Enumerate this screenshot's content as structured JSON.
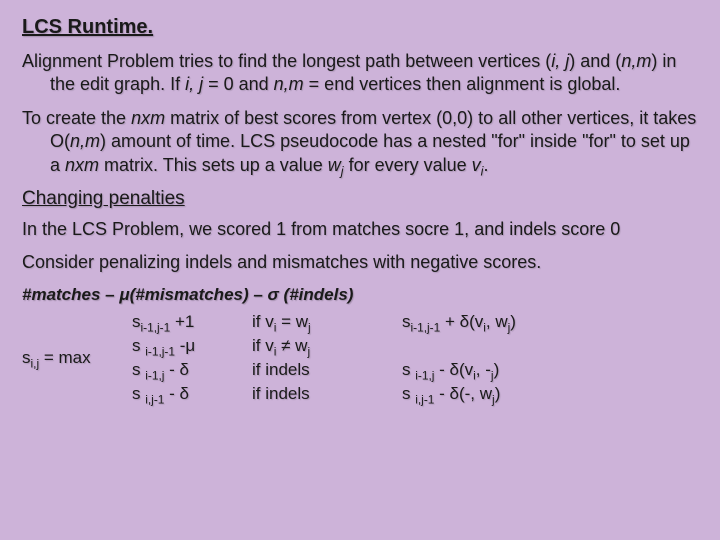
{
  "title": "LCS Runtime.",
  "para1_a": "Alignment Problem tries to find the longest path between vertices (",
  "para1_b": ") and (",
  "para1_c": ") in the edit graph. If ",
  "para1_d": " = 0 and ",
  "para1_e": " = end vertices then alignment is global.",
  "ij": "i, j",
  "nm": "n,m",
  "para2_a": "To create the ",
  "para2_b": " matrix of best scores from vertex (0,0) to all other vertices, it takes O(",
  "para2_c": ") amount of time. LCS pseudocode has a nested \"for\" inside \"for\" to set up a ",
  "para2_d": " matrix. This sets up a value ",
  "para2_e": " for every value ",
  "para2_f": ".",
  "nxm": "nxm",
  "wj": "w",
  "wj_sub": "j",
  "vi": "v",
  "vi_sub": "i",
  "subtitle": "Changing penalties",
  "para3": "In the LCS Problem, we scored 1 from matches socre 1, and indels score 0",
  "para4": "Consider penalizing indels and mismatches with negative scores.",
  "formula_header": "#matches – μ(#mismatches) – σ (#indels)",
  "lhs_a": "s",
  "lhs_sub": "i,j",
  "lhs_b": "  =   max",
  "r1c2_a": "s",
  "r1c2_sub": "i-1,j-1",
  "r1c2_b": " +1",
  "r2c2_a": "s ",
  "r2c2_sub": "i-1,j-1",
  "r2c2_b": " -μ",
  "r3c2_a": "s ",
  "r3c2_sub": "i-1,j",
  "r3c2_b": " - δ",
  "r4c2_a": "s ",
  "r4c2_sub": "i,j-1",
  "r4c2_b": " - δ",
  "r1c3_a": "if v",
  "r1c3_sub1": "i",
  "r1c3_b": " = w",
  "r1c3_sub2": "j",
  "r2c3_a": "if v",
  "r2c3_sub1": "i",
  "r2c3_b": " ≠ w",
  "r2c3_sub2": "j",
  "r3c3": "if indels",
  "r4c3": "if indels",
  "r1c4_a": "s",
  "r1c4_sub": "i-1,j-1",
  "r1c4_b": " + δ(v",
  "r1c4_sub2": "i",
  "r1c4_c": ", w",
  "r1c4_sub3": "j",
  "r1c4_d": ")",
  "r3c4_a": "s ",
  "r3c4_sub": "i-1,j",
  "r3c4_b": " - δ(v",
  "r3c4_sub2": "i",
  "r3c4_c": ", -",
  "r3c4_sub3": "j",
  "r3c4_d": ")",
  "r4c4_a": "s ",
  "r4c4_sub": "i,j-1",
  "r4c4_b": " - δ(-, w",
  "r4c4_sub3": "j",
  "r4c4_d": ")"
}
